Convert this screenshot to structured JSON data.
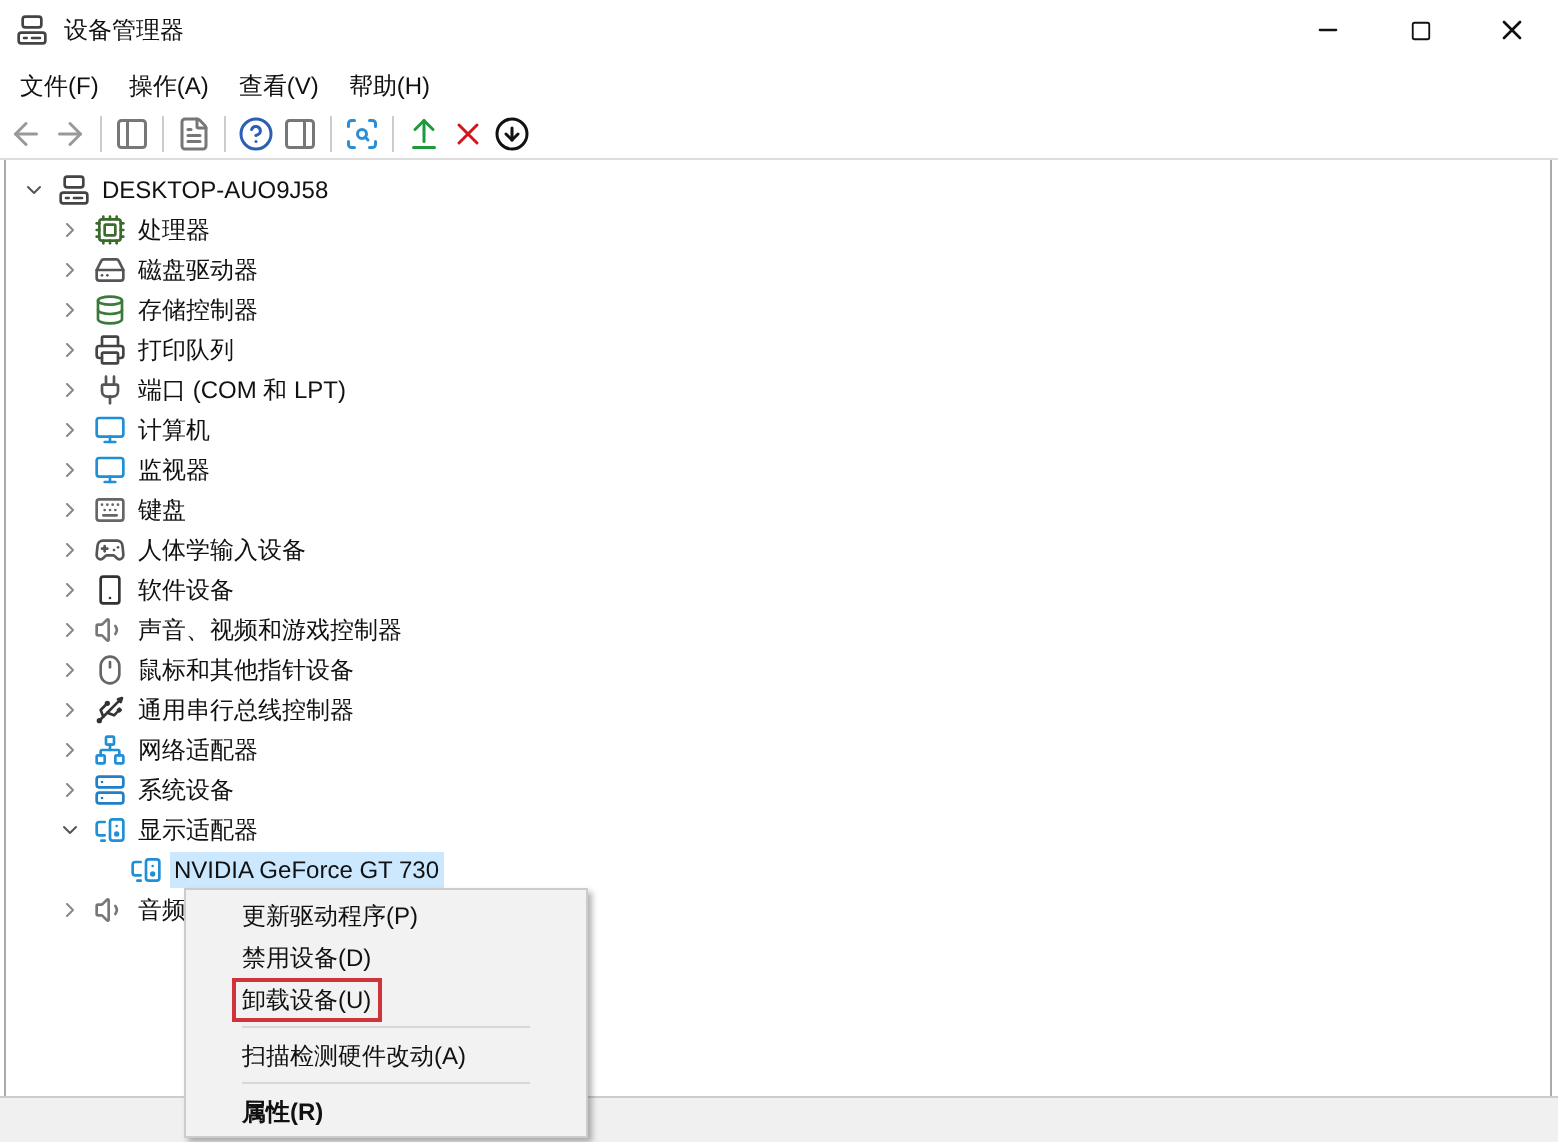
{
  "window": {
    "title": "设备管理器"
  },
  "menu_bar": [
    "文件(F)",
    "操作(A)",
    "查看(V)",
    "帮助(H)"
  ],
  "tree": {
    "label": "DESKTOP-AUO9J58",
    "kind": "computer",
    "expanded": true,
    "selected": false,
    "children": [
      {
        "label": "处理器",
        "kind": "cpu",
        "expanded": false,
        "selected": false
      },
      {
        "label": "磁盘驱动器",
        "kind": "disk",
        "expanded": false,
        "selected": false
      },
      {
        "label": "存储控制器",
        "kind": "storage",
        "expanded": false,
        "selected": false
      },
      {
        "label": "打印队列",
        "kind": "printer",
        "expanded": false,
        "selected": false
      },
      {
        "label": "端口 (COM 和 LPT)",
        "kind": "port",
        "expanded": false,
        "selected": false
      },
      {
        "label": "计算机",
        "kind": "monitor",
        "expanded": false,
        "selected": false
      },
      {
        "label": "监视器",
        "kind": "monitor",
        "expanded": false,
        "selected": false
      },
      {
        "label": "键盘",
        "kind": "keyboard",
        "expanded": false,
        "selected": false
      },
      {
        "label": "人体学输入设备",
        "kind": "hid",
        "expanded": false,
        "selected": false
      },
      {
        "label": "软件设备",
        "kind": "software",
        "expanded": false,
        "selected": false
      },
      {
        "label": "声音、视频和游戏控制器",
        "kind": "speaker",
        "expanded": false,
        "selected": false
      },
      {
        "label": "鼠标和其他指针设备",
        "kind": "mouse",
        "expanded": false,
        "selected": false
      },
      {
        "label": "通用串行总线控制器",
        "kind": "usb",
        "expanded": false,
        "selected": false
      },
      {
        "label": "网络适配器",
        "kind": "network",
        "expanded": false,
        "selected": false
      },
      {
        "label": "系统设备",
        "kind": "system",
        "expanded": false,
        "selected": false
      },
      {
        "label": "显示适配器",
        "kind": "display",
        "expanded": true,
        "selected": false,
        "children": [
          {
            "label": "NVIDIA GeForce GT 730",
            "kind": "display",
            "selected": true
          }
        ]
      },
      {
        "label": "音频",
        "kind": "speaker",
        "expanded": false,
        "selected": false
      }
    ]
  },
  "context_menu": [
    {
      "kind": "item",
      "label": "更新驱动程序(P)",
      "outlined": false,
      "bold": false
    },
    {
      "kind": "item",
      "label": "禁用设备(D)",
      "outlined": false,
      "bold": false
    },
    {
      "kind": "item",
      "label": "卸载设备(U)",
      "outlined": true,
      "bold": false
    },
    {
      "kind": "separator"
    },
    {
      "kind": "item",
      "label": "扫描检测硬件改动(A)",
      "outlined": false,
      "bold": false
    },
    {
      "kind": "separator"
    },
    {
      "kind": "item",
      "label": "属性(R)",
      "outlined": false,
      "bold": true
    }
  ]
}
